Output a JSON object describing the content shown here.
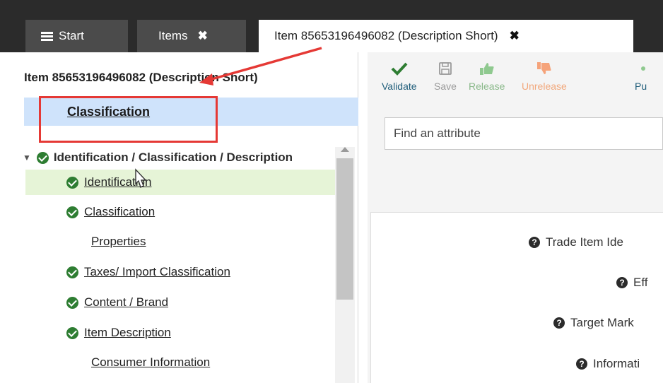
{
  "tabs": [
    {
      "label": "Start"
    },
    {
      "label": "Items",
      "close": "✖"
    },
    {
      "label": "Item 85653196496082 (Description Short)",
      "close": "✖"
    }
  ],
  "left": {
    "heading": "Item 85653196496082 (Description Short)",
    "classification_link": "Classification",
    "tree_root": "Identification / Classification / Description",
    "tree_items": [
      {
        "label": "Identification",
        "checked": true,
        "selected": true
      },
      {
        "label": "Classification",
        "checked": true
      },
      {
        "label": "Properties",
        "checked": false
      },
      {
        "label": "Taxes/ Import Classification",
        "checked": true
      },
      {
        "label": "Content / Brand",
        "checked": true
      },
      {
        "label": "Item Description",
        "checked": true
      },
      {
        "label": "Consumer Information",
        "checked": false
      }
    ]
  },
  "toolbar": {
    "validate": "Validate",
    "save": "Save",
    "release": "Release",
    "unrelease": "Unrelease",
    "publish": "Pu"
  },
  "search": {
    "placeholder": "Find an attribute"
  },
  "attributes": [
    "Trade Item Ide",
    "Eff",
    "Target Mark",
    "Informati"
  ],
  "icons": {
    "check": "check-circle-icon",
    "menu": "hamburger-icon",
    "close": "close-icon",
    "help": "question-circle-icon"
  },
  "colors": {
    "accent_green": "#2e7d32",
    "selection_blue": "#cfe3fb",
    "selection_green": "#e6f4d7",
    "annotation_red": "#e53935"
  }
}
